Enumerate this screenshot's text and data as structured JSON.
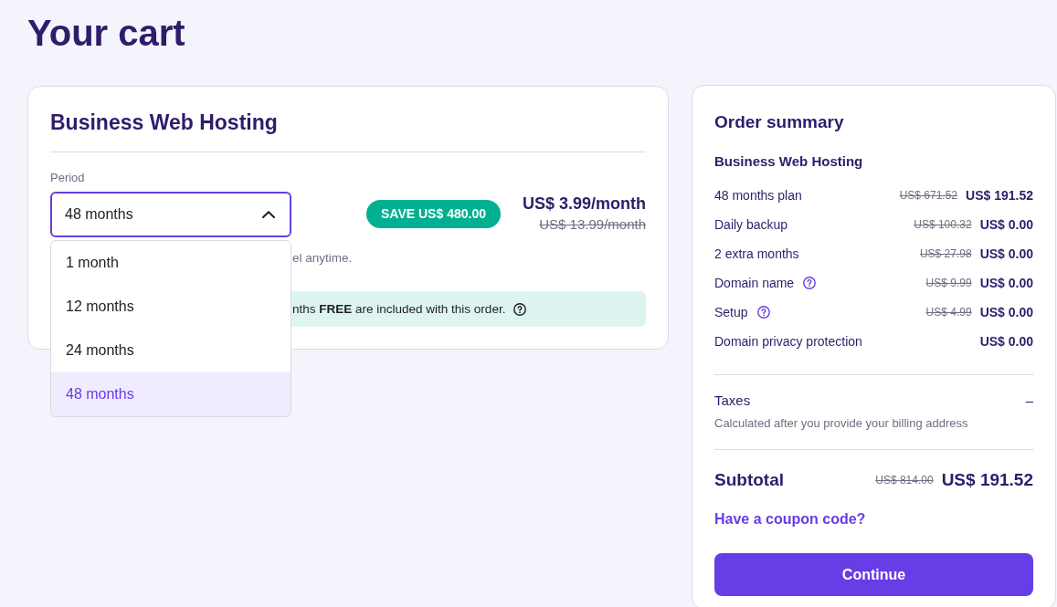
{
  "page_title": "Your cart",
  "product": {
    "title": "Business Web Hosting",
    "period": {
      "label": "Period",
      "value": "48 months",
      "expanded": true,
      "options": [
        {
          "label": "1 month",
          "selected": false
        },
        {
          "label": "12 months",
          "selected": false
        },
        {
          "label": "24 months",
          "selected": false
        },
        {
          "label": "48 months",
          "selected": true
        }
      ]
    },
    "save_badge": "SAVE US$ 480.00",
    "price": "US$ 3.99/month",
    "old_price": "US$ 13.99/month",
    "note": "el anytime.",
    "banner": {
      "text": "nths **FREE** are included with this order.",
      "help": true
    }
  },
  "summary": {
    "title": "Order summary",
    "product": "Business Web Hosting",
    "lines": [
      {
        "label": "48 months plan",
        "help": false,
        "old_price": "US$ 671.52",
        "price": "US$ 191.52"
      },
      {
        "label": "Daily backup",
        "help": false,
        "old_price": "US$ 100.32",
        "price": "US$ 0.00"
      },
      {
        "label": "2 extra months",
        "help": false,
        "old_price": "US$ 27.98",
        "price": "US$ 0.00"
      },
      {
        "label": "Domain name",
        "help": true,
        "old_price": "US$ 9.99",
        "price": "US$ 0.00"
      },
      {
        "label": "Setup",
        "help": true,
        "old_price": "US$ 4.99",
        "price": "US$ 0.00"
      },
      {
        "label": "Domain privacy protection",
        "help": false,
        "price": "US$ 0.00"
      }
    ],
    "taxes": {
      "label": "Taxes",
      "value": "–",
      "note": "Calculated after you provide your billing address"
    },
    "subtotal": {
      "label": "Subtotal",
      "old_price": "US$ 814.00",
      "price": "US$ 191.52"
    },
    "coupon_link": "Have a coupon code?",
    "continue_button": "Continue"
  }
}
